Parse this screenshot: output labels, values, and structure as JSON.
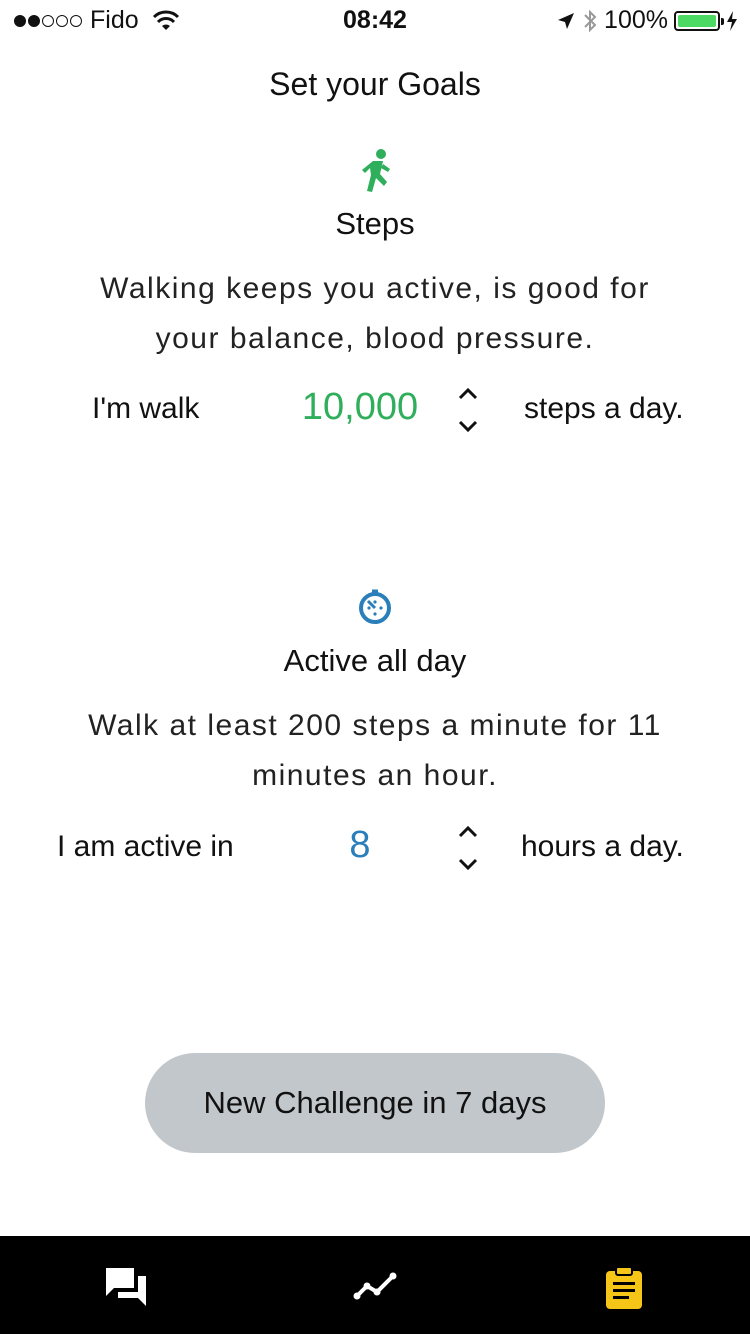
{
  "status_bar": {
    "carrier": "Fido",
    "time": "08:42",
    "battery": "100%",
    "signal_bars_filled": 2,
    "signal_bars_total": 5
  },
  "page": {
    "title": "Set your Goals"
  },
  "steps_goal": {
    "icon": "running-person-icon",
    "title": "Steps",
    "description": "Walking keeps you active, is good for your balance, blood pressure.",
    "prefix": "I'm walk",
    "value": "10,000",
    "suffix": "steps a day.",
    "accent_color": "#2fae5b"
  },
  "active_goal": {
    "icon": "timer-icon",
    "title": "Active all day",
    "description": "Walk at least 200 steps a minute for 11 minutes an hour.",
    "prefix": "I am active in",
    "value": "8",
    "suffix": "hours a day.",
    "accent_color": "#2a7fba"
  },
  "cta": {
    "label": "New Challenge in 7 days"
  },
  "tab_bar": {
    "tabs": [
      {
        "icon": "chat-icon",
        "active": false
      },
      {
        "icon": "trend-line-icon",
        "active": false
      },
      {
        "icon": "clipboard-icon",
        "active": true
      }
    ],
    "active_color": "#f5c518"
  }
}
